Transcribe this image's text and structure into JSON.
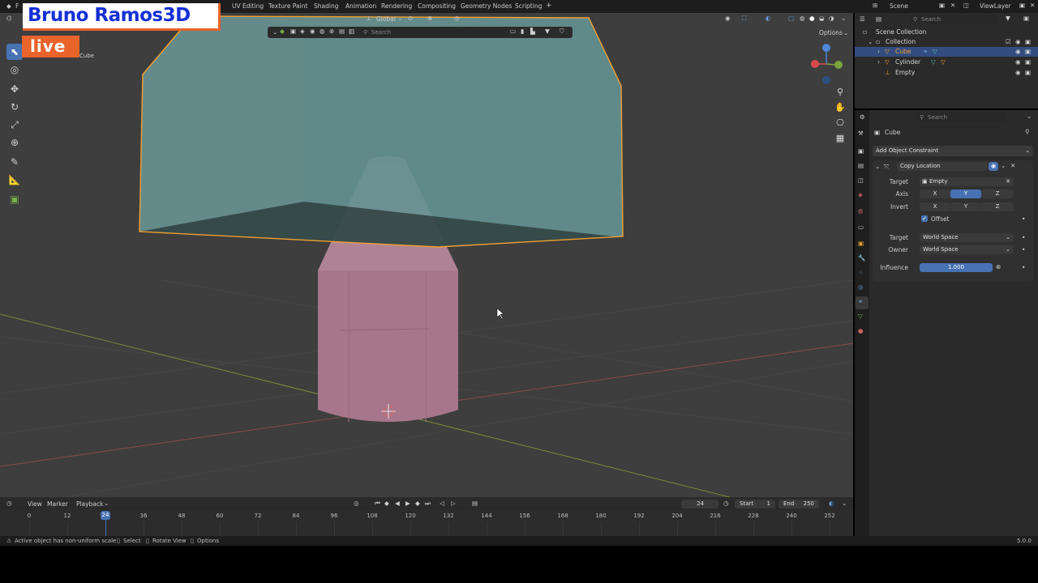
{
  "brand": {
    "name": "Bruno Ramos3D",
    "live": "live"
  },
  "menu": {
    "file_partial": "F"
  },
  "workspace_tabs": [
    "UV Editing",
    "Texture Paint",
    "Shading",
    "Animation",
    "Rendering",
    "Compositing",
    "Geometry Nodes",
    "Scripting"
  ],
  "add_tab_label": "+",
  "scene": {
    "label": "Scene",
    "view_layer": "ViewLayer"
  },
  "viewport": {
    "transform_orientation": "Global",
    "search_placeholder": "Search",
    "options_label": "Options",
    "object_label": "Cube",
    "colors": {
      "background": "#3e3e3e",
      "cube_fill": "#6fa0a0",
      "cube_outline": "#f0a030",
      "cylinder_fill": "#b07a8c"
    }
  },
  "outliner": {
    "search_placeholder": "Search",
    "items": [
      {
        "label": "Scene Collection",
        "level": 0,
        "selected": false
      },
      {
        "label": "Collection",
        "level": 1,
        "selected": false
      },
      {
        "label": "Cube",
        "level": 2,
        "selected": true
      },
      {
        "label": "Cylinder",
        "level": 2,
        "selected": false
      },
      {
        "label": "Empty",
        "level": 2,
        "selected": false
      }
    ]
  },
  "properties": {
    "search_placeholder": "Search",
    "object_name": "Cube",
    "add_constraint_label": "Add Object Constraint",
    "constraint": {
      "name": "Copy Location",
      "target_label": "Target",
      "target_value": "Empty",
      "axis_label": "Axis",
      "invert_label": "Invert",
      "axes": [
        "X",
        "Y",
        "Z"
      ],
      "axis_enabled": [
        false,
        true,
        false
      ],
      "offset_label": "Offset",
      "offset_checked": true,
      "target_space_label": "Target",
      "target_space": "World Space",
      "owner_space_label": "Owner",
      "owner_space": "World Space",
      "influence_label": "Influence",
      "influence_value": "1.000"
    }
  },
  "timeline": {
    "menu": [
      "View",
      "Marker",
      "Playback"
    ],
    "current_frame": "24",
    "start_label": "Start",
    "start_value": "1",
    "end_label": "End",
    "end_value": "250",
    "ticks": [
      "0",
      "12",
      "24",
      "36",
      "48",
      "60",
      "72",
      "84",
      "96",
      "108",
      "120",
      "132",
      "144",
      "156",
      "168",
      "180",
      "192",
      "204",
      "216",
      "228",
      "240",
      "252"
    ],
    "playhead_frame": 24
  },
  "statusbar": {
    "message": "Active object has non-uniform scale",
    "select": "Select",
    "rotate_view": "Rotate View",
    "options": "Options",
    "version": "5.0.0"
  }
}
